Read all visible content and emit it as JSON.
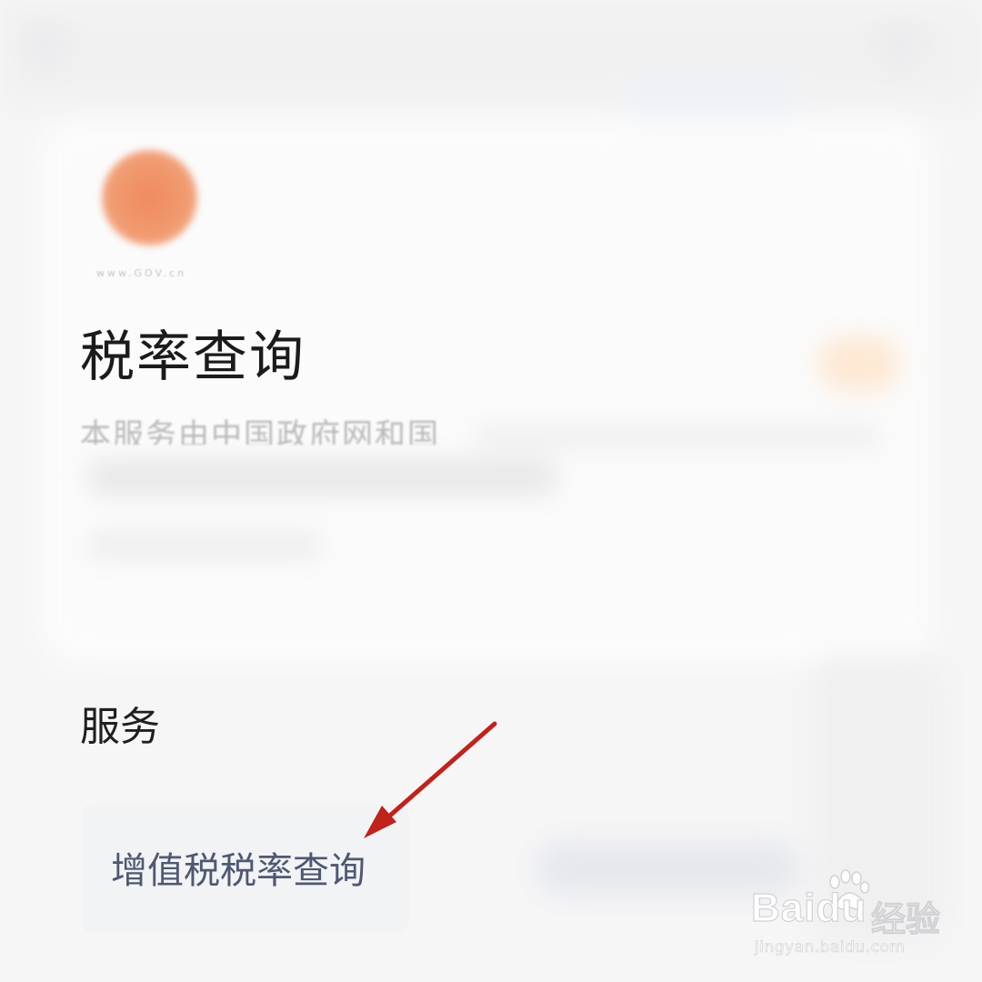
{
  "header": {
    "logo_caption": "www.GOV.cn",
    "logo_color": "#ef8b5e"
  },
  "main": {
    "title": "税率查询",
    "description_partial": "本服务由中国政府网和国"
  },
  "services": {
    "section_title": "服务",
    "items": [
      {
        "label": "增值税税率查询"
      }
    ]
  },
  "annotation": {
    "arrow_color": "#c0221c",
    "points_to": "增值税税率查询"
  },
  "watermark": {
    "brand": "Bai",
    "brand_suffix_latin": "du",
    "brand_suffix_cn": "经验",
    "url": "jingyan.baidu.com",
    "icon": "paw-icon"
  }
}
